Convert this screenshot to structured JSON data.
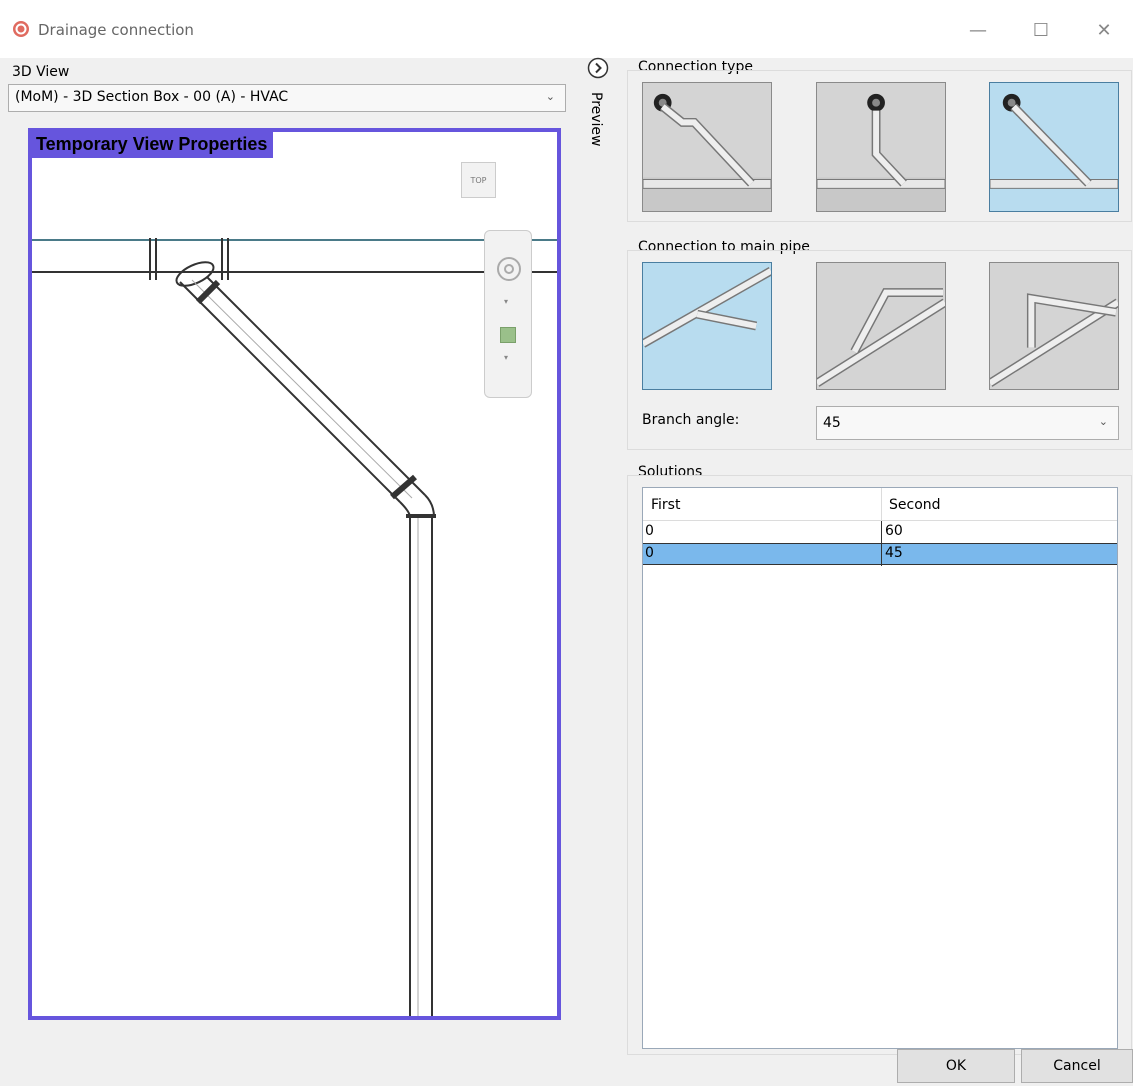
{
  "window": {
    "title": "Drainage connection",
    "controls": {
      "minimize": "—",
      "maximize": "☐",
      "close": "✕"
    }
  },
  "view3d": {
    "label": "3D View",
    "selected_view": "(MoM) - 3D Section Box - 00 (A) - HVAC",
    "viewport_banner": "Temporary View Properties",
    "viewcube_label": "TOP",
    "frame_color": "#6655dd"
  },
  "preview": {
    "label": "Preview",
    "toggle_icon": "chevron-right-circle-icon"
  },
  "connection_type": {
    "label": "Connection type",
    "options": [
      {
        "name": "angled-offset",
        "selected": false
      },
      {
        "name": "vertical-drop",
        "selected": false
      },
      {
        "name": "straight-45",
        "selected": true
      }
    ]
  },
  "connection_to_main": {
    "label": "Connection to main pipe",
    "options": [
      {
        "name": "horizontal",
        "selected": true
      },
      {
        "name": "rise-over",
        "selected": false
      },
      {
        "name": "rise-vertical",
        "selected": false
      }
    ],
    "branch_angle_label": "Branch angle:",
    "branch_angle_value": "45"
  },
  "solutions": {
    "label": "Solutions",
    "columns": [
      "First",
      "Second"
    ],
    "rows": [
      {
        "first": "0",
        "second": "60",
        "selected": false
      },
      {
        "first": "0",
        "second": "45",
        "selected": true
      }
    ]
  },
  "buttons": {
    "ok": "OK",
    "cancel": "Cancel"
  },
  "colors": {
    "selection": "#7ab8ec",
    "tile_selected": "#b8dcef",
    "accent": "#6655dd"
  }
}
